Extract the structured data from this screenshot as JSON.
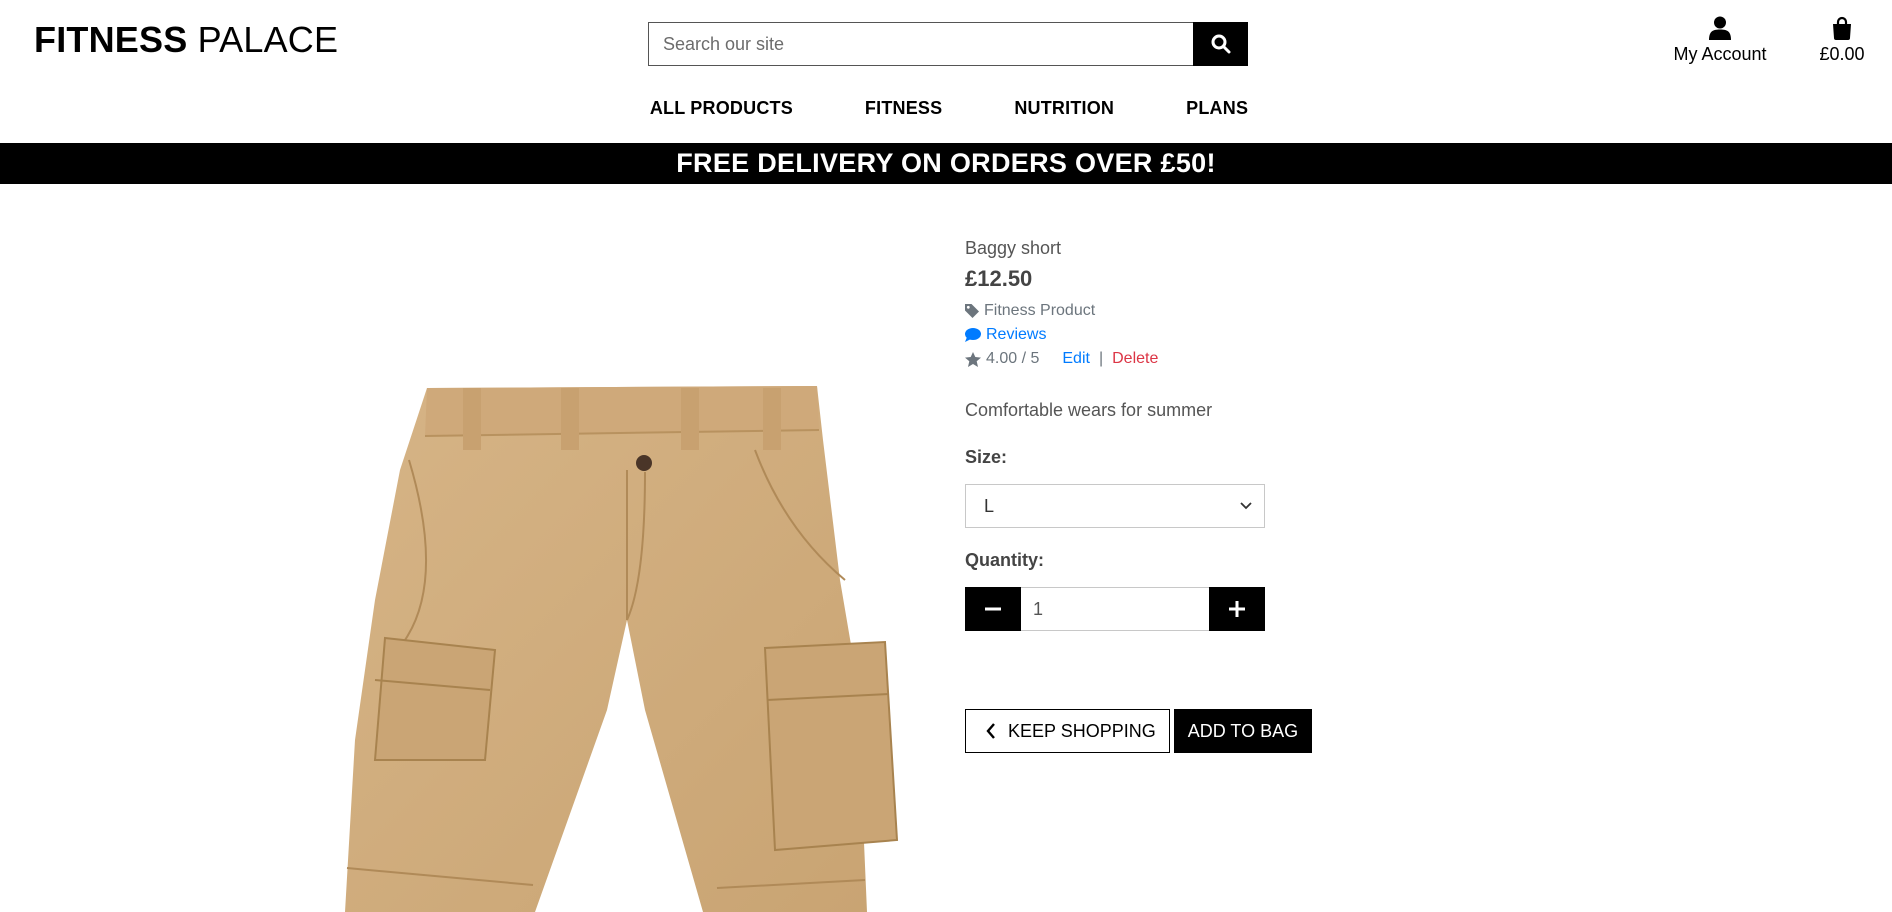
{
  "header": {
    "brand_bold": "FITNESS",
    "brand_light": "PALACE",
    "search_placeholder": "Search our site",
    "account_label": "My Account",
    "bag_total": "£0.00"
  },
  "nav": {
    "items": [
      "ALL PRODUCTS",
      "FITNESS",
      "NUTRITION",
      "PLANS"
    ]
  },
  "banner": {
    "text": "FREE DELIVERY ON ORDERS OVER £50!"
  },
  "product": {
    "name": "Baggy short",
    "price": "£12.50",
    "category": "Fitness Product",
    "reviews_label": "Reviews",
    "rating": "4.00 / 5",
    "edit_label": "Edit",
    "separator": "|",
    "delete_label": "Delete",
    "description": "Comfortable wears for summer",
    "size_label": "Size:",
    "size_value": "L",
    "quantity_label": "Quantity:",
    "quantity_value": "1",
    "image_desc": "khaki cargo shorts"
  },
  "actions": {
    "keep_shopping": "KEEP SHOPPING",
    "add_to_bag": "ADD TO BAG"
  },
  "colors": {
    "link": "#007bff",
    "danger": "#dc3545",
    "muted": "#6c757d",
    "khaki": "#d2ae7e"
  }
}
